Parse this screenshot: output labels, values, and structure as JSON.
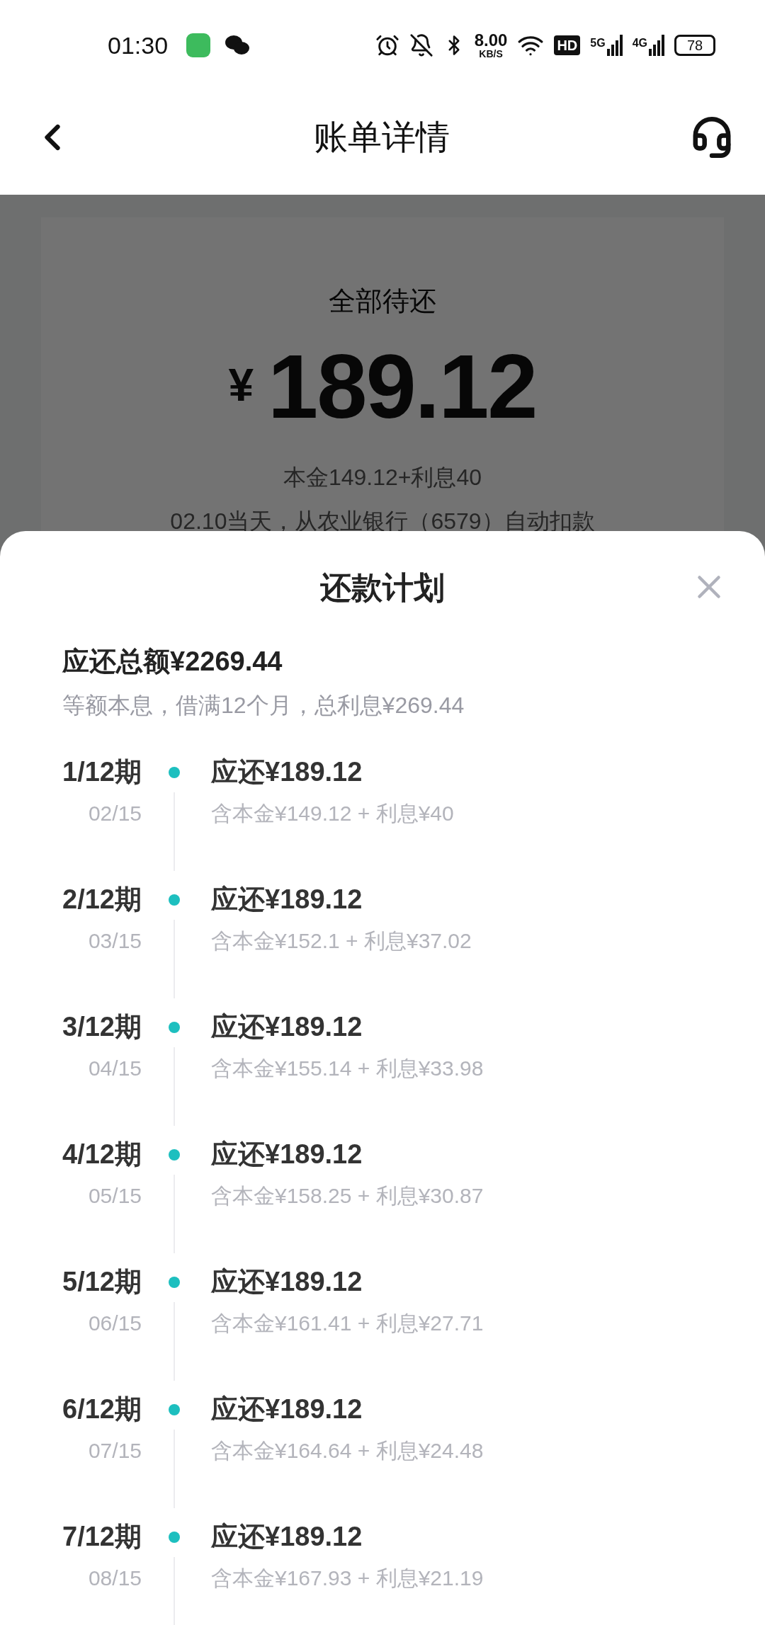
{
  "status_bar": {
    "time": "01:30",
    "speed": "8.00",
    "speed_unit": "KB/S",
    "hd": "HD",
    "networks": [
      "5G",
      "4G"
    ],
    "battery": "78"
  },
  "header": {
    "title": "账单详情"
  },
  "summary": {
    "label": "全部待还",
    "currency": "¥",
    "amount": "189.12",
    "breakdown": "本金149.12+利息40",
    "autopay": "02.10当天，从农业银行（6579）自动扣款"
  },
  "sheet": {
    "title": "还款计划",
    "total": "应还总额¥2269.44",
    "description": "等额本息，借满12个月，总利息¥269.44",
    "periods": [
      {
        "period": "1/12期",
        "date": "02/15",
        "amount": "应还¥189.12",
        "detail": "含本金¥149.12 + 利息¥40"
      },
      {
        "period": "2/12期",
        "date": "03/15",
        "amount": "应还¥189.12",
        "detail": "含本金¥152.1 + 利息¥37.02"
      },
      {
        "period": "3/12期",
        "date": "04/15",
        "amount": "应还¥189.12",
        "detail": "含本金¥155.14 + 利息¥33.98"
      },
      {
        "period": "4/12期",
        "date": "05/15",
        "amount": "应还¥189.12",
        "detail": "含本金¥158.25 + 利息¥30.87"
      },
      {
        "period": "5/12期",
        "date": "06/15",
        "amount": "应还¥189.12",
        "detail": "含本金¥161.41 + 利息¥27.71"
      },
      {
        "period": "6/12期",
        "date": "07/15",
        "amount": "应还¥189.12",
        "detail": "含本金¥164.64 + 利息¥24.48"
      },
      {
        "period": "7/12期",
        "date": "08/15",
        "amount": "应还¥189.12",
        "detail": "含本金¥167.93 + 利息¥21.19"
      }
    ]
  }
}
